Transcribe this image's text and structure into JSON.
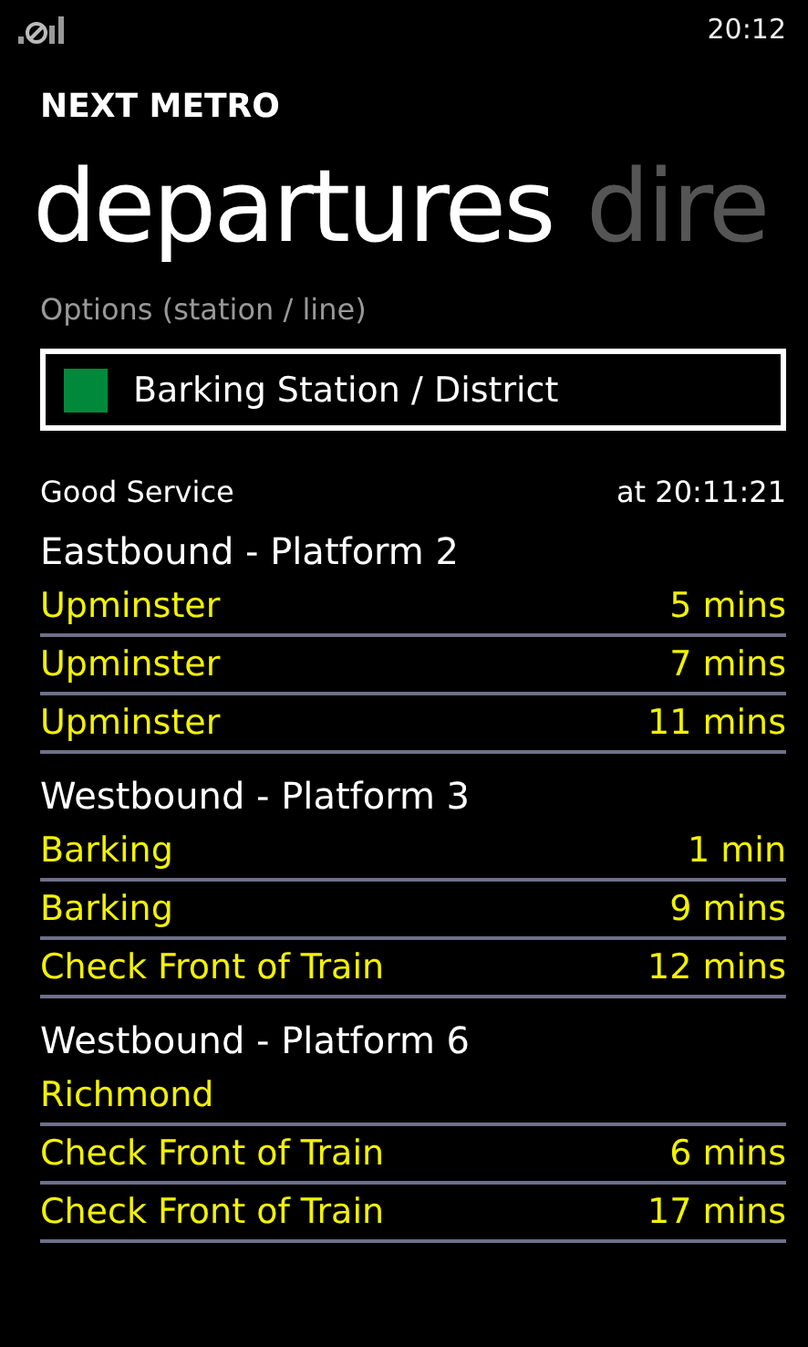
{
  "status_bar": {
    "time": "20:12"
  },
  "app_title": "NEXT METRO",
  "pivot": [
    {
      "label": "departures",
      "selected": true
    },
    {
      "label": "dire",
      "selected": false
    }
  ],
  "options": {
    "label": "Options (station / line)",
    "value": "Barking Station / District"
  },
  "status": {
    "service": "Good Service",
    "updated": "at 20:11:21"
  },
  "groups": [
    {
      "title": "Eastbound - Platform 2",
      "departures": [
        {
          "destination": "Upminster",
          "due": "5 mins"
        },
        {
          "destination": "Upminster",
          "due": "7 mins"
        },
        {
          "destination": "Upminster",
          "due": "11 mins"
        }
      ]
    },
    {
      "title": "Westbound - Platform 3",
      "departures": [
        {
          "destination": "Barking",
          "due": "1 min"
        },
        {
          "destination": "Barking",
          "due": "9 mins"
        },
        {
          "destination": "Check Front of Train",
          "due": "12 mins"
        }
      ]
    },
    {
      "title": "Westbound - Platform 6",
      "departures": [
        {
          "destination": "Richmond"
        },
        {
          "destination": "Check Front of Train",
          "due": "6 mins"
        },
        {
          "destination": "Check Front of Train",
          "due": "17 mins"
        }
      ]
    }
  ]
}
